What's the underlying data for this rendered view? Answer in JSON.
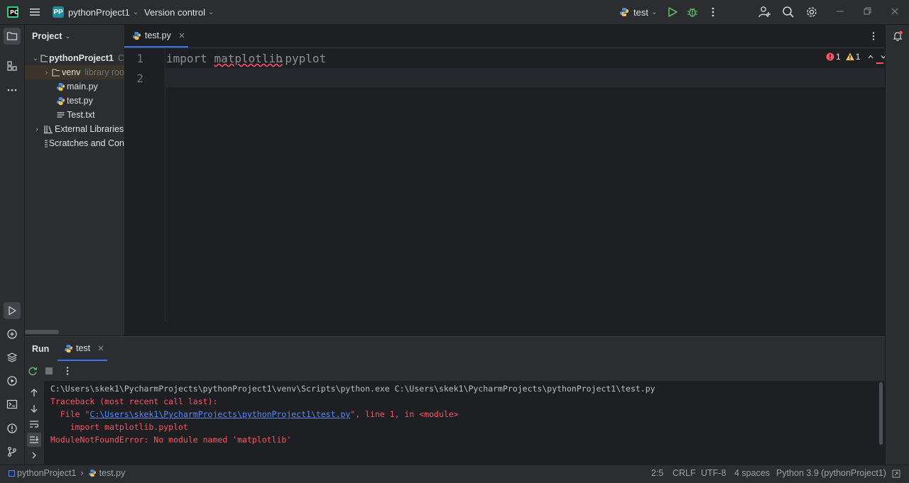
{
  "topbar": {
    "project_badge": "PP",
    "project_name": "pythonProject1",
    "version_control": "Version control",
    "run_config": "test"
  },
  "project_panel": {
    "title": "Project",
    "tree": [
      {
        "label": "pythonProject1",
        "suffix": "C",
        "icon": "folder-icon",
        "expanded": true
      },
      {
        "label": "venv",
        "suffix": "library roo",
        "icon": "folder-icon",
        "expanded": false
      },
      {
        "label": "main.py",
        "icon": "python-file-icon"
      },
      {
        "label": "test.py",
        "icon": "python-file-icon"
      },
      {
        "label": "Test.txt",
        "icon": "text-file-icon"
      },
      {
        "label": "External Libraries",
        "icon": "library-icon",
        "expanded": false
      },
      {
        "label": "Scratches and Con",
        "icon": "scratches-icon"
      }
    ]
  },
  "editor": {
    "tab_label": "test.py",
    "lines": [
      {
        "num": "1",
        "keyword": "import",
        "module": "matplotlib",
        "rest": ".pyplot"
      },
      {
        "num": "2",
        "keyword": "",
        "module": "",
        "rest": ""
      }
    ],
    "inspections": {
      "errors": "1",
      "warnings": "1"
    }
  },
  "run_panel": {
    "title": "Run",
    "tab_label": "test",
    "console": {
      "command": "C:\\Users\\skek1\\PycharmProjects\\pythonProject1\\venv\\Scripts\\python.exe C:\\Users\\skek1\\PycharmProjects\\pythonProject1\\test.py",
      "traceback_header": "Traceback (most recent call last):",
      "file_prefix": "  File \"",
      "file_link": "C:\\Users\\skek1\\PycharmProjects\\pythonProject1\\test.py",
      "file_suffix": "\", line 1, in <module>",
      "code_line": "    import matplotlib.pyplot",
      "error_line": "ModuleNotFoundError: No module named 'matplotlib'"
    }
  },
  "statusbar": {
    "breadcrumb_project": "pythonProject1",
    "breadcrumb_file": "test.py",
    "position": "2:5",
    "line_sep": "CRLF",
    "encoding": "UTF-8",
    "indent": "4 spaces",
    "interpreter": "Python 3.9 (pythonProject1)"
  },
  "colors": {
    "error": "#f75464",
    "link": "#548af7",
    "run_green": "#5fb865",
    "warning": "#f2c55c"
  }
}
